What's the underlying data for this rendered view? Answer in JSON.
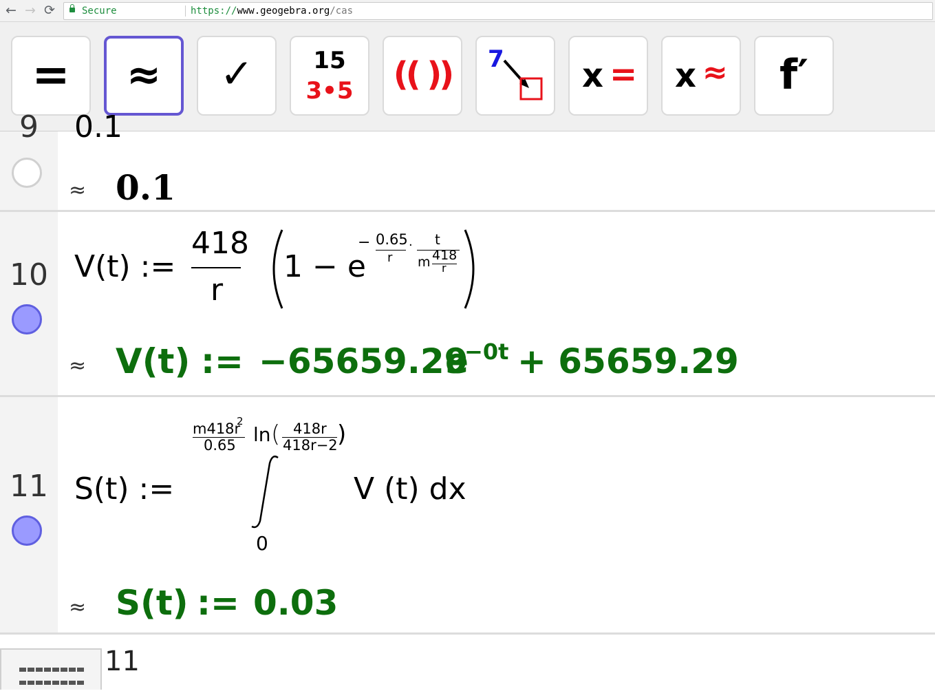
{
  "browser": {
    "back": "←",
    "forward": "→",
    "reload": "⟳",
    "secure_label": "Secure",
    "url_scheme": "https://",
    "url_host": "www.geogebra.org",
    "url_path": "/cas"
  },
  "toolbar": {
    "evaluate": "=",
    "numeric": "≈",
    "keep_input": "✓",
    "factor_top": "15",
    "factor_bottom": "3•5",
    "expand": "(( ))",
    "substitute_num": "7",
    "solve_x": "x",
    "solve_eq": "=",
    "nsolve_x": "x",
    "nsolve_approx": "≈",
    "derivative": "f′",
    "selected_tool": "numeric"
  },
  "rows": [
    {
      "number": "9",
      "input": "0.1",
      "approx_symbol": "≈",
      "output": "0.1",
      "active": false
    },
    {
      "number": "10",
      "input_lhs": "V(t) :=",
      "frac_num": "418",
      "frac_den": "r",
      "one_minus": "1 − e",
      "exp_minus": "−",
      "exp_frac1_num": "0.65",
      "exp_frac1_den": "r",
      "exp_dot": "·",
      "exp_frac2_num": "t",
      "exp_frac2_den_m": "m",
      "exp_frac2_den_num": "418",
      "exp_frac2_den_den": "r",
      "approx_symbol": "≈",
      "out_lhs": "V(t)",
      "out_assign": ":=",
      "out_coef": "−65659.29",
      "out_e": "e",
      "out_exp": "−0t",
      "out_plus": "+ 65659.29",
      "active": true
    },
    {
      "number": "11",
      "input_lhs": "S(t) :=",
      "upper_frac_num": "m418r",
      "upper_frac_num_sup": "2",
      "upper_frac_den": "0.65",
      "upper_ln": "ln",
      "upper_ln_num": "418r",
      "upper_ln_den": "418r−2",
      "lower": "0",
      "integral_sign": "∫",
      "integrand": "V (t)  dx",
      "approx_symbol": "≈",
      "out_lhs": "S(t)",
      "out_assign": ":=",
      "out_value": "0.03",
      "active": true
    }
  ],
  "next_row_number": "11",
  "colors": {
    "output_green": "#0d6e0d",
    "selected_border": "#6557d2",
    "active_circle": "#9a9aff",
    "red_glyph": "#e8121a",
    "blue_glyph": "#1818e0"
  }
}
